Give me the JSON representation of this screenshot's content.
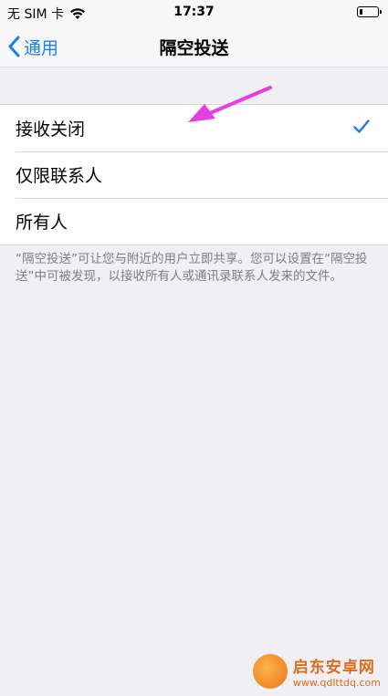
{
  "status_bar": {
    "carrier": "无 SIM 卡",
    "time": "17:37"
  },
  "nav": {
    "back_label": "通用",
    "title": "隔空投送"
  },
  "options": [
    {
      "label": "接收关闭",
      "selected": true
    },
    {
      "label": "仅限联系人",
      "selected": false
    },
    {
      "label": "所有人",
      "selected": false
    }
  ],
  "footer_note": "“隔空投送”可让您与附近的用户立即共享。您可以设置在“隔空投送”中可被发现，以接收所有人或通讯录联系人发来的文件。",
  "watermark": {
    "name": "启东安卓网",
    "url": "www.qdlttdq.com"
  },
  "colors": {
    "accent": "#1a7cf5",
    "annotation_arrow": "#e83ee0",
    "background": "#efeff4"
  }
}
